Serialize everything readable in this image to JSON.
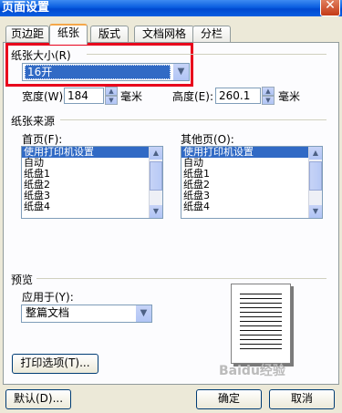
{
  "window": {
    "title": "页面设置"
  },
  "tabs": [
    "页边距",
    "纸张",
    "版式",
    "文档网格",
    "分栏"
  ],
  "paper_size": {
    "label": "纸张大小(R)",
    "value": "16开",
    "width_label": "宽度(W):",
    "width_value": "184",
    "height_label": "高度(E):",
    "height_value": "260.1",
    "unit": "毫米"
  },
  "paper_source": {
    "label": "纸张来源",
    "first_page_label": "首页(F):",
    "other_pages_label": "其他页(O):",
    "first_page_items": [
      "使用打印机设置",
      "自动",
      "纸盘1",
      "纸盘2",
      "纸盘3",
      "纸盘4"
    ],
    "other_pages_items": [
      "使用打印机设置",
      "自动",
      "纸盘1",
      "纸盘2",
      "纸盘3",
      "纸盘4"
    ]
  },
  "preview": {
    "label": "预览",
    "apply_to_label": "应用于(Y):",
    "apply_to_value": "整篇文档",
    "print_options_label": "打印选项(T)..."
  },
  "footer": {
    "default_label": "默认(D)...",
    "ok_label": "确定",
    "cancel_label": "取消"
  },
  "watermark": "Baidu经验"
}
